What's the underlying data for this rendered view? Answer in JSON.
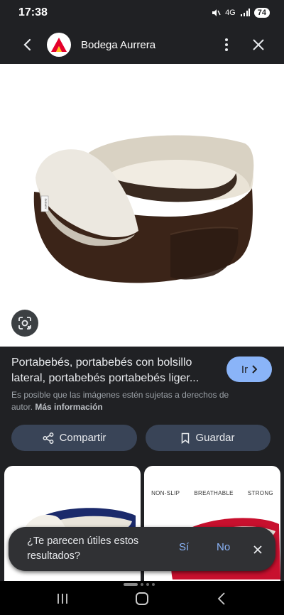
{
  "status": {
    "time": "17:38",
    "network": "4G",
    "battery": "74"
  },
  "app_bar": {
    "site_name": "Bodega Aurrera"
  },
  "product": {
    "title": "Portabebés, portabebés con bolsillo lateral, portabebés portabebés liger...",
    "go_label": "Ir",
    "copyright_text": "Es posible que las imágenes estén sujetas a derechos de autor.",
    "more_info_label": "Más información",
    "brand_tag": "DISNEY"
  },
  "actions": {
    "share_label": "Compartir",
    "save_label": "Guardar"
  },
  "results": {
    "card2_tags": [
      "NON-SLIP",
      "BREATHABLE",
      "STRONG"
    ]
  },
  "feedback": {
    "question": "¿Te parecen útiles estos resultados?",
    "yes_label": "Sí",
    "no_label": "No"
  },
  "colors": {
    "accent": "#8ab4f8",
    "button_bg": "#394457",
    "panel_bg": "#202124"
  }
}
